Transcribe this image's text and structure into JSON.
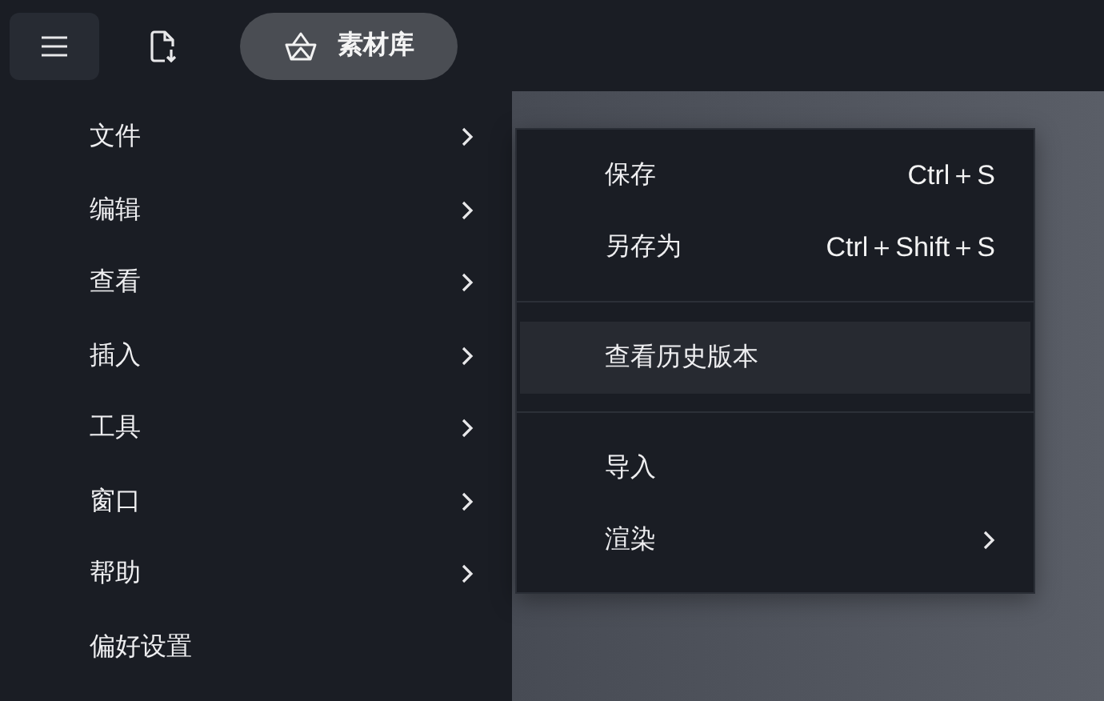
{
  "toolbar": {
    "menu_button": {
      "selected": true
    },
    "library_button": {
      "label": "素材库"
    }
  },
  "main_menu": {
    "items": [
      {
        "label": "文件",
        "kind": "submenu"
      },
      {
        "label": "编辑",
        "kind": "submenu"
      },
      {
        "label": "查看",
        "kind": "submenu"
      },
      {
        "label": "插入",
        "kind": "submenu"
      },
      {
        "label": "工具",
        "kind": "submenu"
      },
      {
        "label": "窗口",
        "kind": "submenu"
      },
      {
        "label": "帮助",
        "kind": "submenu"
      },
      {
        "label": "偏好设置",
        "kind": "action"
      }
    ]
  },
  "file_submenu": {
    "items": [
      {
        "kind": "action",
        "label": "保存",
        "shortcut": "Ctrl＋S",
        "selected": false
      },
      {
        "kind": "action",
        "label": "另存为",
        "shortcut": "Ctrl＋Shift＋S",
        "selected": false
      },
      {
        "kind": "separator"
      },
      {
        "kind": "action",
        "label": "查看历史版本",
        "selected": true
      },
      {
        "kind": "separator"
      },
      {
        "kind": "action",
        "label": "导入",
        "selected": false
      },
      {
        "kind": "submenu",
        "label": "渲染",
        "selected": false
      }
    ]
  }
}
